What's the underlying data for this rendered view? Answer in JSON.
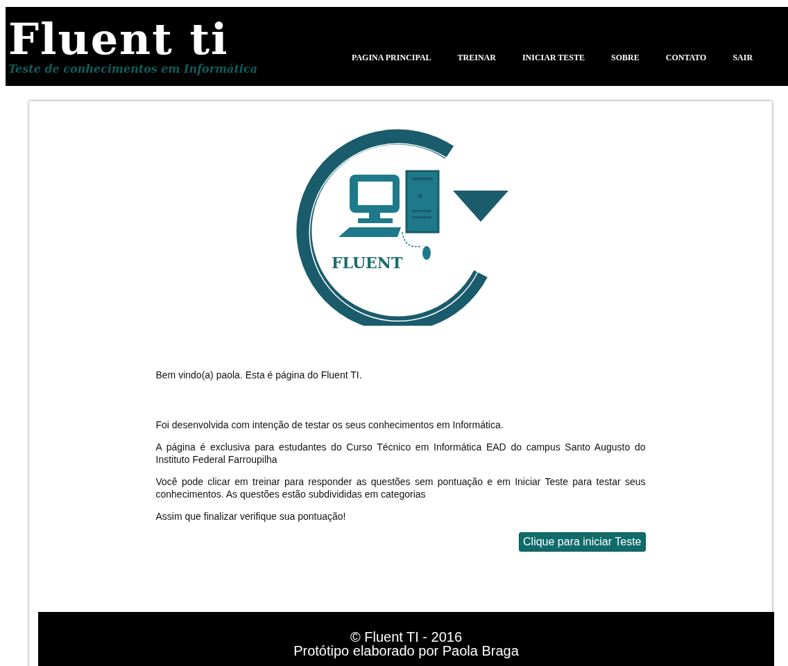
{
  "header": {
    "brand": "Fluent ti",
    "tagline": "Teste de conhecimentos em Informática",
    "nav": [
      "PAGINA PRINCIPAL",
      "TREINAR",
      "INICIAR TESTE",
      "SOBRE",
      "CONTATO",
      "SAIR"
    ]
  },
  "logo": {
    "text": "FLUENT"
  },
  "welcome": "Bem vindo(a) paola. Esta é página do Fluent TI.",
  "paragraphs": [
    "Foi desenvolvida com intenção de testar os seus conhecimentos em Informática.",
    "A página é exclusiva para estudantes do Curso Técnico em Informática EAD do campus Santo Augusto do Instituto Federal Farroupilha",
    "Você pode clicar em treinar para responder as questões sem pontuação e em Iniciar Teste para testar seus conhecimentos. As questões estão subdivididas em categorias",
    "Assim que finalizar verifique sua pontuação!"
  ],
  "start_button": "Clique para iniciar Teste",
  "footer": {
    "copyright": "© Fluent TI - 2016",
    "credit": "Protótipo elaborado por Paola Braga"
  }
}
